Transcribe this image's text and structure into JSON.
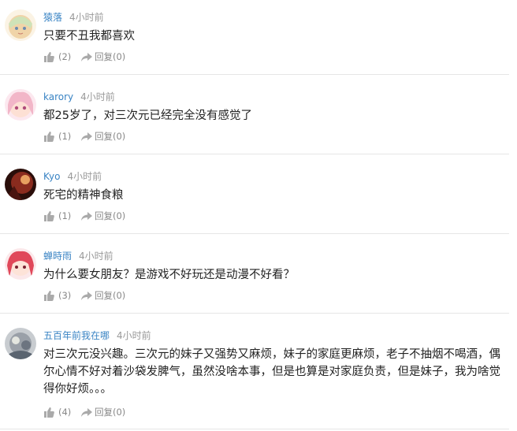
{
  "comments": [
    {
      "username": "猿落",
      "time": "4小时前",
      "text": "只要不丑我都喜欢",
      "likes": "(2)",
      "reply": "回复",
      "replies": "(0)",
      "avatar_color": "#f0d4a8"
    },
    {
      "username": "karory",
      "time": "4小时前",
      "text": "都25岁了，对三次元已经完全没有感觉了",
      "likes": "(1)",
      "reply": "回复",
      "replies": "(0)",
      "avatar_color": "#f2b6c8"
    },
    {
      "username": "Kyo",
      "time": "4小时前",
      "text": "死宅的精神食粮",
      "likes": "(1)",
      "reply": "回复",
      "replies": "(0)",
      "avatar_color": "#8a2b1e"
    },
    {
      "username": "蝉時雨",
      "time": "4小时前",
      "text": "为什么要女朋友？是游戏不好玩还是动漫不好看？",
      "likes": "(3)",
      "reply": "回复",
      "replies": "(0)",
      "avatar_color": "#e0485a"
    },
    {
      "username": "五百年前我在哪",
      "time": "4小时前",
      "text": "对三次元没兴趣。三次元的妹子又强势又麻烦，妹子的家庭更麻烦，老子不抽烟不喝酒，偶尔心情不好对着沙袋发脾气，虽然没啥本事，但是也算是对家庭负责，但是妹子，我为啥觉得你好烦。。。",
      "likes": "(4)",
      "reply": "回复",
      "replies": "(0)",
      "avatar_color": "#9aa0a8"
    }
  ],
  "colors": {
    "username": "#3a84c4",
    "timestamp": "#999999",
    "divider": "#e6e6e6"
  }
}
